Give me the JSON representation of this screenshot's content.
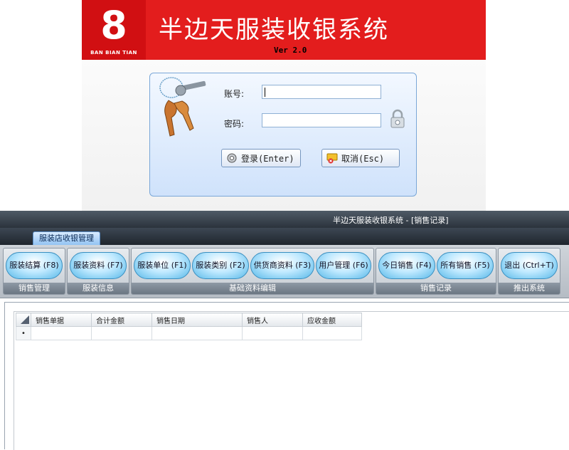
{
  "login": {
    "logo_digit": "8",
    "logo_text": "BAN BIAN TIAN",
    "app_title": "半边天服装收银系统",
    "version": "Ver 2.0",
    "account_label": "账号:",
    "account_value": "",
    "password_label": "密码:",
    "password_value": "",
    "login_button": "登录(Enter)",
    "cancel_button": "取消(Esc)"
  },
  "window": {
    "title": "半边天服装收银系统 - [销售记录]",
    "tab": "服装店收银管理"
  },
  "ribbon": {
    "groups": [
      {
        "caption": "销售管理",
        "buttons": [
          "服装结算 (F8)"
        ]
      },
      {
        "caption": "服装信息",
        "buttons": [
          "服装资料 (F7)"
        ]
      },
      {
        "caption": "基础资料编辑",
        "buttons": [
          "服装单位 (F1)",
          "服装类别 (F2)",
          "供货商资料 (F3)",
          "用户管理 (F6)"
        ]
      },
      {
        "caption": "销售记录",
        "buttons": [
          "今日销售 (F4)",
          "所有销售 (F5)"
        ]
      },
      {
        "caption": "推出系统",
        "buttons": [
          "退出 (Ctrl+T)"
        ]
      }
    ]
  },
  "grid": {
    "columns": [
      "销售单据",
      "合计金额",
      "销售日期",
      "销售人",
      "应收金额"
    ],
    "new_row_marker": "•"
  },
  "colors": {
    "banner_red": "#e31d1d",
    "logo_red": "#d10f12",
    "titlebar": "#2b333c",
    "pill_blue": "#57b8e8"
  }
}
